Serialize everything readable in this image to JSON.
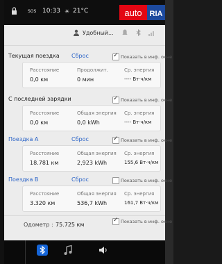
{
  "status": {
    "sos": "SOS",
    "time": "10:33",
    "temp": "21°C"
  },
  "watermark": {
    "auto": "auto",
    "ria": "RIA"
  },
  "profile": {
    "name": "Удобный..."
  },
  "sections": [
    {
      "title": "Текущая поездка",
      "reset": "Сброс",
      "checked": true,
      "check_label": "Показать в инф. окне",
      "labels": [
        "Расстояние",
        "Продолжит.",
        "Ср. энергия"
      ],
      "values": [
        "0,0 км",
        "0 мин",
        "---- Вт·ч/км"
      ]
    },
    {
      "title": "С последней зарядки",
      "reset": "",
      "checked": true,
      "check_label": "Показать в инф. окне",
      "labels": [
        "Расстояние",
        "Общая энергия",
        "Ср. энергия"
      ],
      "values": [
        "0,0 км",
        "0,0 kWh",
        "---- Вт·ч/км"
      ]
    },
    {
      "title": "Поездка А",
      "reset": "Сброс",
      "checked": true,
      "check_label": "Показать в инф. окне",
      "labels": [
        "Расстояние",
        "Общая энергия",
        "Ср. энергия"
      ],
      "values": [
        "18.781 км",
        "2,923 kWh",
        "155,6 Вт·ч/км"
      ]
    },
    {
      "title": "Поездка В",
      "reset": "Сброс",
      "checked": false,
      "check_label": "Показать в инф. окне",
      "labels": [
        "Расстояние",
        "Общая энергия",
        "Ср. энергия"
      ],
      "values": [
        "3.320 км",
        "536,7 kWh",
        "161,7 Вт·ч/км"
      ]
    }
  ],
  "odometer": {
    "label": "Одометр :",
    "value": "75.725 км",
    "checked": true,
    "check_label": "Показать в инф. окне"
  },
  "icons": [
    "lock-icon",
    "person-icon",
    "bell-icon",
    "bluetooth-icon",
    "signal-icon",
    "music-icon",
    "volume-icon"
  ],
  "colors": {
    "accent": "#2a63c7",
    "panel": "#ececec",
    "bar": "#0e0e0e"
  }
}
